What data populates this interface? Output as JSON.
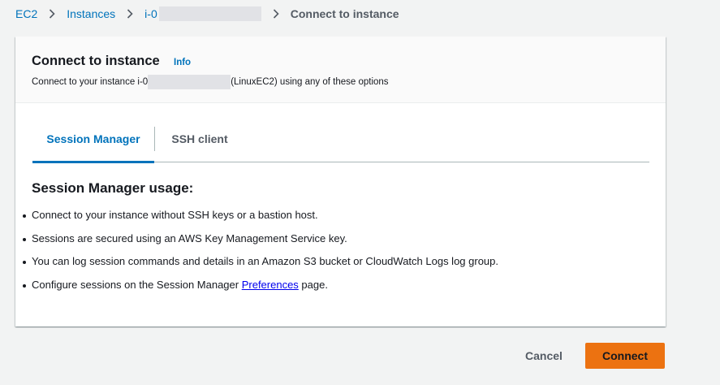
{
  "breadcrumb": {
    "items": [
      "EC2",
      "Instances",
      "i-0"
    ],
    "current": "Connect to instance"
  },
  "panel": {
    "title": "Connect to instance",
    "info_label": "Info",
    "desc_prefix": "Connect to your instance i-0",
    "desc_suffix": "(LinuxEC2) using any of these options"
  },
  "tabs": [
    {
      "label": "Session Manager",
      "selected": true
    },
    {
      "label": "SSH client",
      "selected": false
    }
  ],
  "usage": {
    "heading": "Session Manager usage:",
    "bullets": [
      "Connect to your instance without SSH keys or a bastion host.",
      "Sessions are secured using an AWS Key Management Service key.",
      "You can log session commands and details in an Amazon S3 bucket or CloudWatch Logs log group."
    ],
    "last_prefix": "Configure sessions on the Session Manager ",
    "last_link": "Preferences",
    "last_suffix": " page."
  },
  "actions": {
    "cancel_label": "Cancel",
    "connect_label": "Connect"
  },
  "colors": {
    "link": "#0073bb",
    "primary_button": "#ec7211",
    "background": "#f2f3f3"
  }
}
